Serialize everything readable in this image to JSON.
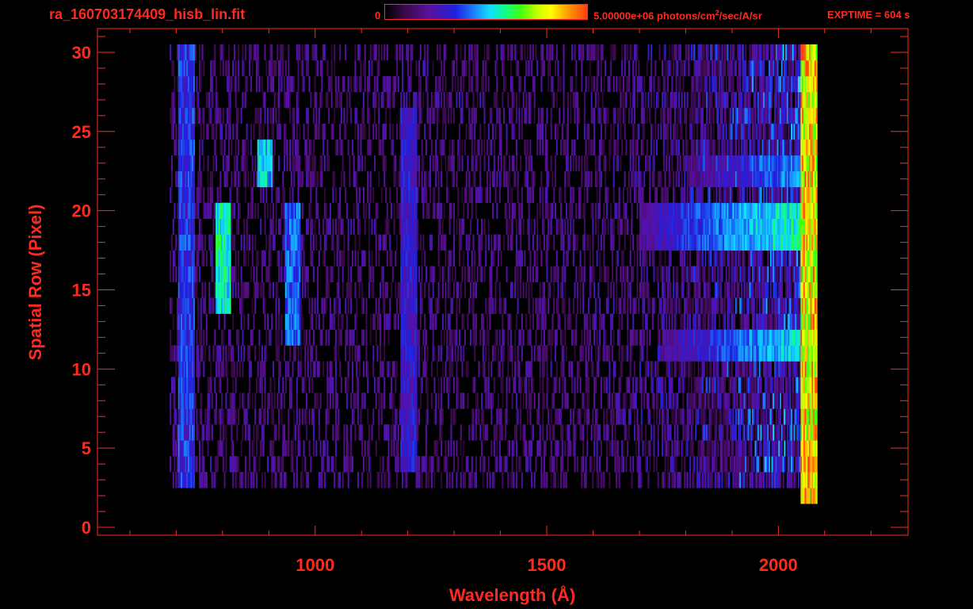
{
  "header": {
    "file_title": "ra_160703174409_hisb_lin.fit",
    "colorbar_min": "0",
    "colorbar_max_pre": "5.00000e+06 photons/cm",
    "colorbar_max_sup": "2",
    "colorbar_max_post": "/sec/A/sr",
    "exptime": "EXPTIME = 604 s"
  },
  "colors": {
    "axis": "#ff2a1f",
    "background": "#000000",
    "colormap": [
      "#000000",
      "#3a0a4a",
      "#5a10a0",
      "#2020e0",
      "#1a8cff",
      "#10e0ff",
      "#10ff80",
      "#40ff10",
      "#c0ff00",
      "#ffff00",
      "#ffa000",
      "#ff4010"
    ]
  },
  "chart_data": {
    "type": "heatmap",
    "title": "ra_160703174409_hisb_lin.fit",
    "xlabel": "Wavelength (Å)",
    "ylabel": "Spatial Row (Pixel)",
    "xlim": [
      530,
      2280
    ],
    "ylim": [
      -0.5,
      31.5
    ],
    "x_ticks": [
      1000,
      1500,
      2000
    ],
    "y_ticks": [
      0,
      5,
      10,
      15,
      20,
      25,
      30
    ],
    "colorbar_range": [
      0,
      5000000
    ],
    "colorbar_units": "photons/cm^2/sec/A/sr",
    "signal_x_range": [
      685,
      2075
    ],
    "features": [
      {
        "feature": "arc-left-edge",
        "x": 800,
        "y_range": [
          14,
          20
        ],
        "level": 0.52
      },
      {
        "feature": "arc-peak",
        "x": 890,
        "y_range": [
          22,
          24
        ],
        "level": 0.45
      },
      {
        "feature": "arc-right-edge",
        "x": 950,
        "y_range": [
          12,
          20
        ],
        "level": 0.35
      },
      {
        "feature": "horizontal-band",
        "x_range": [
          1700,
          2075
        ],
        "y_range": [
          18,
          20
        ],
        "level": 0.55
      },
      {
        "feature": "horizontal-band",
        "x_range": [
          1750,
          2075
        ],
        "y_range": [
          11,
          12
        ],
        "level": 0.5
      },
      {
        "feature": "horizontal-band",
        "x_range": [
          1800,
          2075
        ],
        "y_range": [
          22,
          23
        ],
        "level": 0.4
      },
      {
        "feature": "red-edge",
        "x": 2065,
        "y_range": [
          2,
          30
        ],
        "level": 0.85
      },
      {
        "feature": "faint-line",
        "x": 1200,
        "y_range": [
          4,
          26
        ],
        "level": 0.25
      },
      {
        "feature": "faint-line",
        "x": 720,
        "y_range": [
          3,
          30
        ],
        "level": 0.3
      }
    ]
  }
}
